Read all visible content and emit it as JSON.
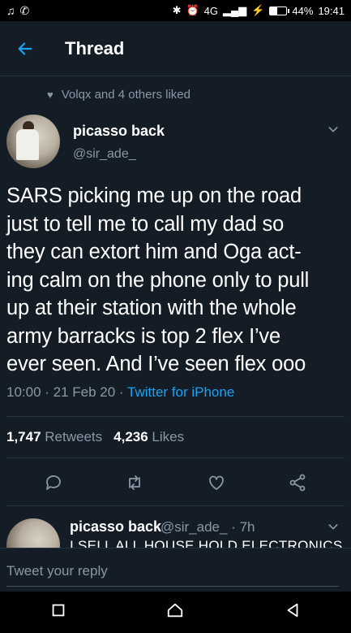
{
  "status_bar": {
    "battery": "44%",
    "time": "19:41",
    "signal": "4G"
  },
  "header": {
    "title": "Thread"
  },
  "social_context": {
    "text": "Volqx and 4 others liked"
  },
  "tweet": {
    "author_name": "picasso back",
    "author_handle": "@sir_ade_",
    "lines": [
      "SARS picking me up on the road",
      "just to tell me to call my dad so",
      "they can extort him and Oga act-",
      "ing calm on the phone only to pull",
      "up at their station with the whole",
      "army barracks is top 2 flex I’ve",
      "ever seen. And I’ve seen flex ooo"
    ],
    "time": "10:00 · 21 Feb 20 · ",
    "source": "Twitter for iPhone",
    "retweets_count": "1,747",
    "retweets_label": " Retweets",
    "likes_count": "4,236",
    "likes_label": " Likes"
  },
  "reply": {
    "author_name": "picasso back",
    "author_handle": "@sir_ade_ · 7h",
    "text": "I SELL ALL HOUSE HOLD ELECTRONICS"
  },
  "reply_input": {
    "placeholder": "Tweet your reply"
  },
  "colors": {
    "background": "#141d26",
    "accent": "#1da1f2",
    "muted": "#8899a6",
    "divider": "#243447"
  }
}
